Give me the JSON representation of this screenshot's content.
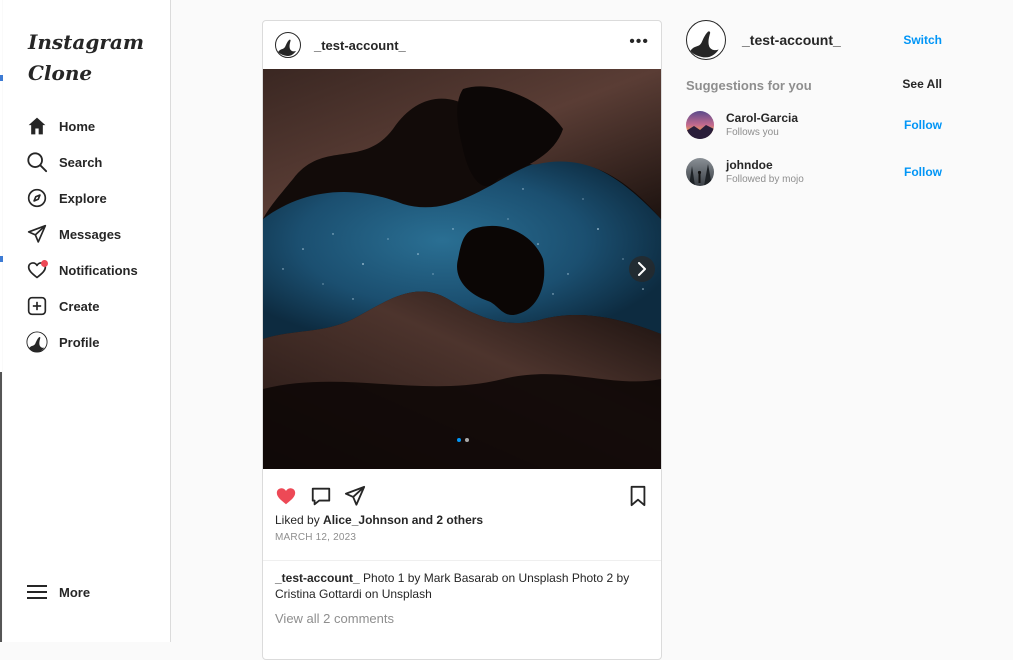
{
  "app": {
    "logo": "Instagram Clone"
  },
  "sidebar": {
    "items": [
      {
        "label": "Home",
        "icon": "home-icon"
      },
      {
        "label": "Search",
        "icon": "search-icon"
      },
      {
        "label": "Explore",
        "icon": "compass-icon"
      },
      {
        "label": "Messages",
        "icon": "send-icon"
      },
      {
        "label": "Notifications",
        "icon": "heart-icon"
      },
      {
        "label": "Create",
        "icon": "plus-square-icon"
      },
      {
        "label": "Profile",
        "icon": "avatar-icon"
      }
    ],
    "more_label": "More"
  },
  "post": {
    "username": "_test-account_",
    "menu_icon": "more-dots-icon",
    "carousel": {
      "current_slide": 1,
      "total_slides": 2
    },
    "liked": true,
    "likes_prefix": "Liked by",
    "likes_text": "Alice_Johnson and 2 others",
    "date": "MARCH 12, 2023",
    "caption_user": "_test-account_",
    "caption_text": "Photo 1 by Mark Basarab on Unsplash Photo 2 by Cristina Gottardi on Unsplash",
    "view_comments": "View all 2 comments"
  },
  "profile_panel": {
    "username": "_test-account_",
    "switch_label": "Switch",
    "suggestions_title": "Suggestions for you",
    "see_all_label": "See All",
    "suggestions": [
      {
        "name": "Carol-Garcia",
        "subtitle": "Follows you",
        "action": "Follow"
      },
      {
        "name": "johndoe",
        "subtitle": "Followed by mojo",
        "action": "Follow"
      }
    ]
  },
  "colors": {
    "accent_blue": "#0095f6",
    "like_red": "#ed4956",
    "text": "#262626",
    "muted": "#8e8e8e",
    "border": "#dbdbdb"
  }
}
